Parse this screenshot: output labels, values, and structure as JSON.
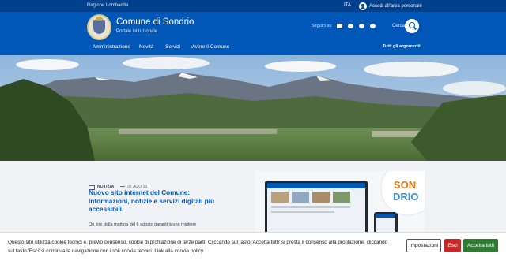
{
  "slim": {
    "region": "Regione Lombardia",
    "language": "ITA",
    "login": "Accedi all'area personale"
  },
  "header": {
    "title": "Comune di Sondrio",
    "subtitle": "Portale istituzionale",
    "follow_label": "Seguici su",
    "social_icons": [
      "youtube-icon",
      "flickr-icon",
      "cloud-icon",
      "apple-icon"
    ],
    "search_label": "Cerca"
  },
  "nav": {
    "items": [
      "Amministrazione",
      "Novità",
      "Servizi",
      "Vivere il Comune"
    ],
    "all_topics": "Tutti gli argomenti..."
  },
  "news": {
    "category": "NOTIZIA",
    "date": "07 AGO 23",
    "title": "Nuovo sito internet del Comune: informazioni, notizie e servizi digitali più accessibili.",
    "excerpt": "On line dalla mattina del 6 agosto garantirà una migliore",
    "badge_text": "SON DRIO"
  },
  "cookie": {
    "text": "Questo sito utilizza cookie tecnici e, previo consenso, cookie di profilazione di terze parti. Cliccando sul tasto 'Accetta tutti' si presta il consenso alla profilazione, cliccando sul tasto 'Esci' si continua la navigazione con i soli cookie tecnici. Link alla cookie policy",
    "settings": "Impostazioni",
    "exit": "Esci",
    "accept": "Accetta tutti"
  },
  "colors": {
    "primary": "#0057b8",
    "slim": "#00408c",
    "exit": "#c62828",
    "accept": "#2e7d32"
  }
}
